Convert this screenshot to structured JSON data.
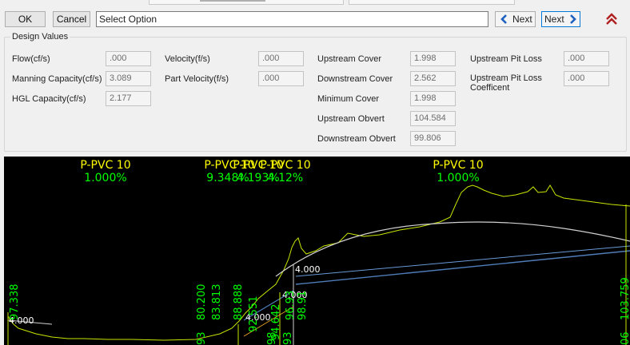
{
  "toolbar": {
    "ok_label": "OK",
    "cancel_label": "Cancel",
    "select_value": "Select Option",
    "prev_label": "Next",
    "next_label": "Next"
  },
  "design_values": {
    "title": "Design Values",
    "flow": {
      "label": "Flow(cf/s)",
      "value": ".000"
    },
    "manning_capacity": {
      "label": "Manning Capacity(cf/s)",
      "value": "3.089"
    },
    "hgl_capacity": {
      "label": "HGL Capacity(cf/s)",
      "value": "2.177"
    },
    "velocity": {
      "label": "Velocity(f/s)",
      "value": ".000"
    },
    "part_velocity": {
      "label": "Part Velocity(f/s)",
      "value": ".000"
    },
    "upstream_cover": {
      "label": "Upstream Cover",
      "value": "1.998"
    },
    "downstream_cover": {
      "label": "Downstream Cover",
      "value": "2.562"
    },
    "minimum_cover": {
      "label": "Minimum Cover",
      "value": "1.998"
    },
    "upstream_obvert": {
      "label": "Upstream Obvert",
      "value": "104.584"
    },
    "downstream_obvert": {
      "label": "Downstream Obvert",
      "value": "99.806"
    },
    "upstream_pit_loss": {
      "label": "Upstream Pit Loss",
      "value": ".000"
    },
    "upstream_pit_loss_coefficent": {
      "label": "Upstream Pit Loss Coefficent",
      "value": ".000"
    }
  },
  "profile": {
    "pipe_labels": [
      {
        "name": "P-PVC 10",
        "grade": "1.000%"
      },
      {
        "name": "P-PVC 10",
        "grade": "9.348%"
      },
      {
        "name": "P-PVC 10",
        "grade": "4.193%"
      },
      {
        "name": "P-PVC 10",
        "grade": "4.12%"
      },
      {
        "name": "P-PVC 10",
        "grade": "1.000%"
      }
    ],
    "depth_labels": [
      "4.000",
      "4.000",
      "4.000",
      "4.000"
    ],
    "vertical_numbers": [
      "97.338",
      "80.200",
      "83.813",
      "88.888",
      "92.551",
      "94.642",
      "96.93",
      "98.91",
      "103.759"
    ],
    "clipped_numbers": [
      "93",
      "98",
      "93",
      "06"
    ],
    "colors": {
      "ground": "#c8e600",
      "pipe_invert": "#4f7db8",
      "hgl": "#d4d4d4",
      "label_yellow": "#ffff00",
      "label_green": "#00ff00",
      "energy": "#e0a020"
    }
  }
}
